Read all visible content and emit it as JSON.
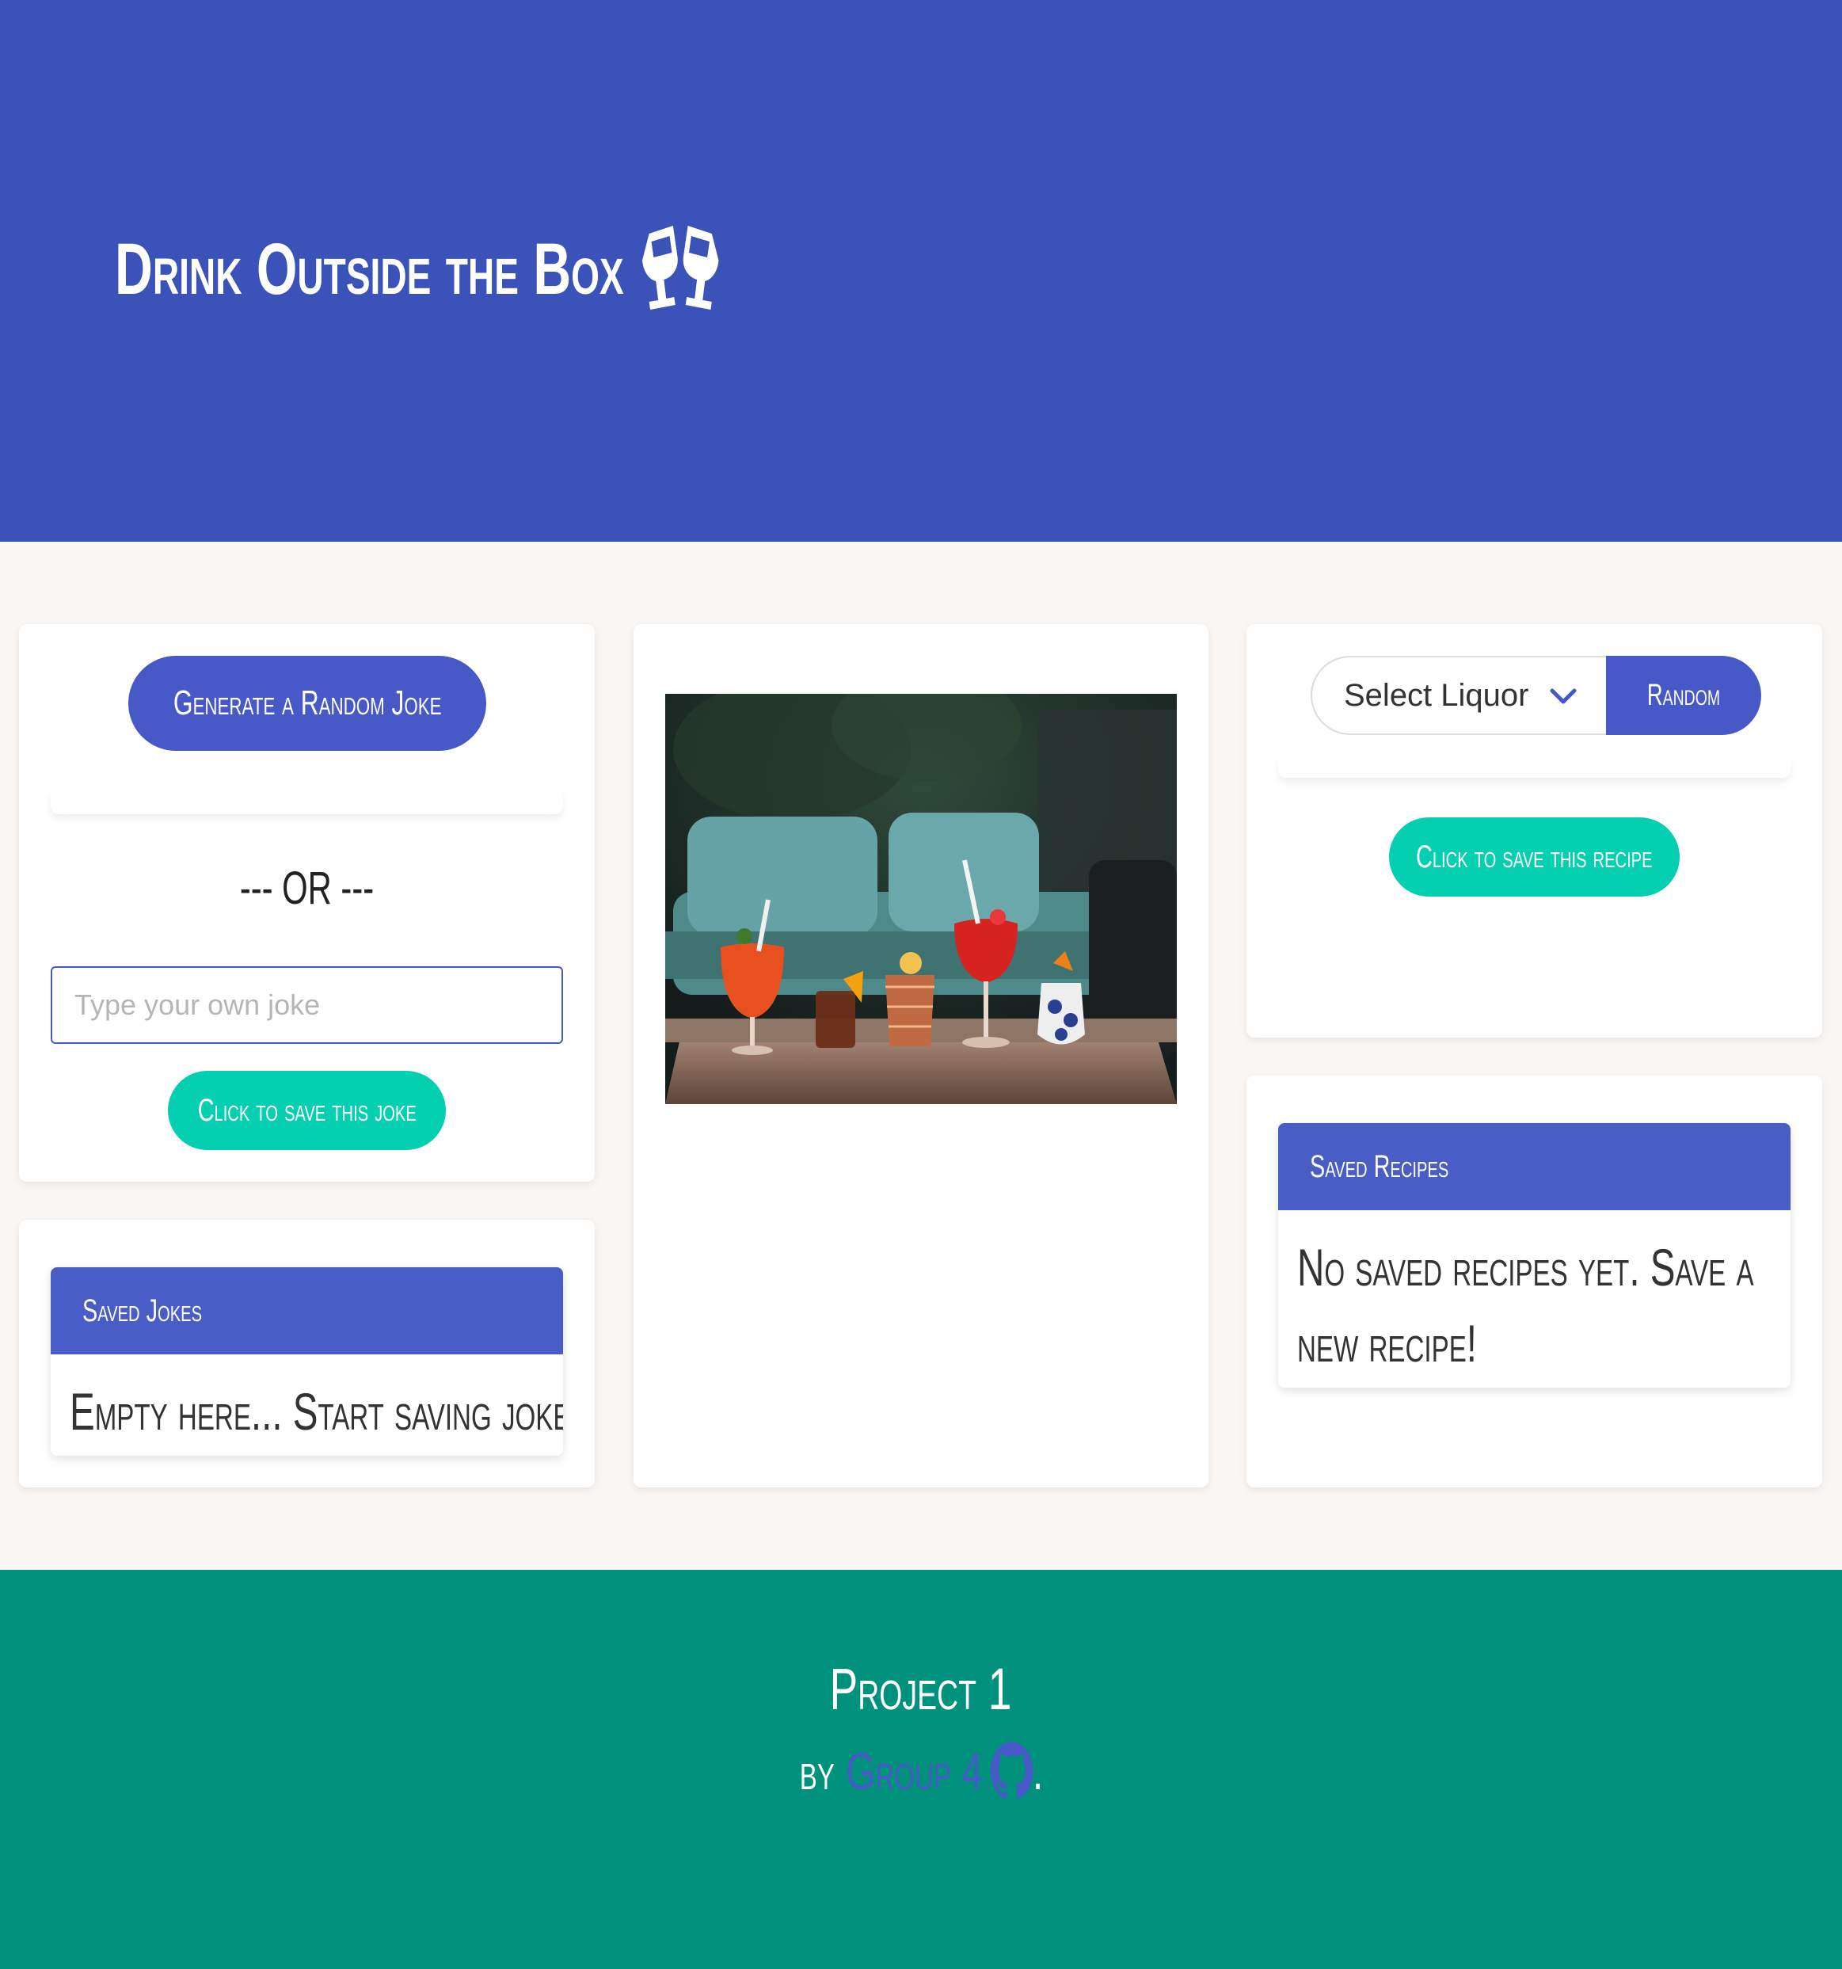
{
  "header": {
    "title": "Drink Outside the Box",
    "icon": "glasses-cheers-icon",
    "background": "#3b52b9"
  },
  "jokes": {
    "generate_label": "Generate a Random Joke",
    "or_label": "--- OR ---",
    "input_placeholder": "Type your own joke",
    "input_value": "",
    "save_label": "Click to save this joke",
    "saved_title": "Saved Jokes",
    "saved_empty": "Empty here... Start saving jokes!"
  },
  "recipes": {
    "select_value": "Select Liquor",
    "random_label": "Random",
    "save_label": "Click to save this recipe",
    "saved_title": "Saved Recipes",
    "saved_empty": "No saved recipes yet. Save a new recipe!"
  },
  "footer": {
    "title": "Project 1",
    "by_prefix": "by",
    "group_link": "Group 4",
    "suffix": ".",
    "background": "#00917c"
  },
  "colors": {
    "accent_blue": "#4659c6",
    "accent_teal": "#04d0b1"
  }
}
